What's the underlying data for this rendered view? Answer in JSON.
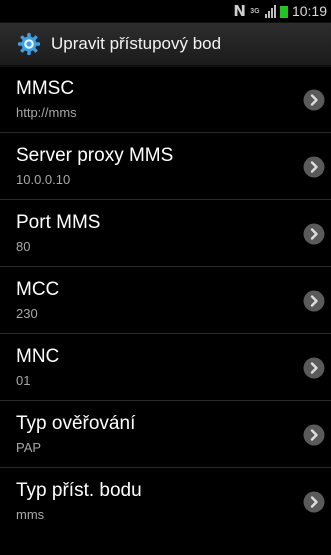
{
  "status_bar": {
    "nfc_label": "N",
    "network_label": "3G",
    "time": "10:19",
    "battery_color": "#22c322"
  },
  "header": {
    "title": "Upravit přístupový bod",
    "icon": "gear-icon",
    "accent_color": "#3ba0e6"
  },
  "settings": [
    {
      "label": "MMSC",
      "value": "http://mms"
    },
    {
      "label": "Server proxy MMS",
      "value": "10.0.0.10"
    },
    {
      "label": "Port MMS",
      "value": "80"
    },
    {
      "label": "MCC",
      "value": "230"
    },
    {
      "label": "MNC",
      "value": "01"
    },
    {
      "label": "Typ ověřování",
      "value": "PAP"
    },
    {
      "label": "Typ příst. bodu",
      "value": "mms"
    }
  ]
}
